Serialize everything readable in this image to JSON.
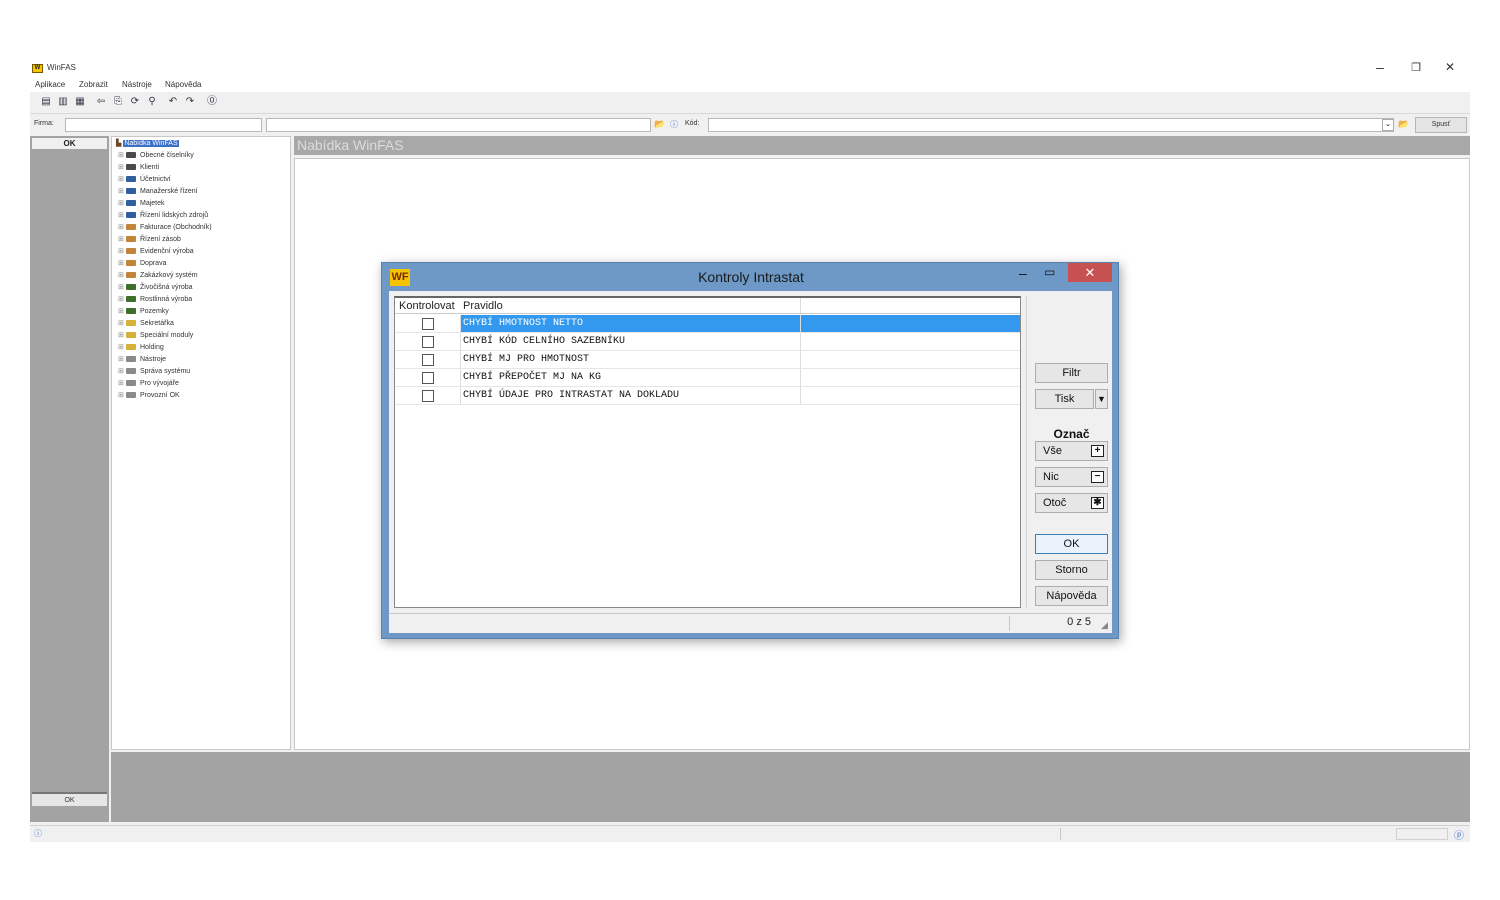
{
  "window": {
    "title": "WinFAS",
    "controls": {
      "minimize": "–",
      "restore": "❐",
      "close": "✕"
    }
  },
  "menu": [
    "Aplikace",
    "Zobrazit",
    "Nástroje",
    "Nápověda"
  ],
  "firma_row": {
    "firma_label": "Firma:",
    "kod_label": "Kód:",
    "spust_label": "Spusť"
  },
  "left_panel": {
    "ok_top": "OK",
    "ok_bottom": "OK"
  },
  "tree": {
    "root": "Nabídka WinFAS",
    "items": [
      {
        "label": "Obecné číselníky",
        "color": "#4a4a4a"
      },
      {
        "label": "Klienti",
        "color": "#4a4a4a"
      },
      {
        "label": "Účetnictví",
        "color": "#2f5f9f"
      },
      {
        "label": "Manažerské řízení",
        "color": "#2f5f9f"
      },
      {
        "label": "Majetek",
        "color": "#2f5f9f"
      },
      {
        "label": "Řízení lidských zdrojů",
        "color": "#2f5f9f"
      },
      {
        "label": "Fakturace (Obchodník)",
        "color": "#c0843a"
      },
      {
        "label": "Řízení zásob",
        "color": "#c0843a"
      },
      {
        "label": "Evidenční výroba",
        "color": "#c0843a"
      },
      {
        "label": "Doprava",
        "color": "#c0843a"
      },
      {
        "label": "Zakázkový systém",
        "color": "#c0843a"
      },
      {
        "label": "Živočišná výroba",
        "color": "#3f6e2b"
      },
      {
        "label": "Rostlinná výroba",
        "color": "#3f6e2b"
      },
      {
        "label": "Pozemky",
        "color": "#3f6e2b"
      },
      {
        "label": "Sekretářka",
        "color": "#d4b23a"
      },
      {
        "label": "Speciální moduly",
        "color": "#d4b23a"
      },
      {
        "label": "Holding",
        "color": "#d4b23a"
      },
      {
        "label": "Nástroje",
        "color": "#8a8a8a"
      },
      {
        "label": "Správa systému",
        "color": "#8a8a8a"
      },
      {
        "label": "Pro vývojáře",
        "color": "#8a8a8a"
      },
      {
        "label": "Provozní OK",
        "color": "#8a8a8a"
      }
    ]
  },
  "main": {
    "header": "Nabídka WinFAS"
  },
  "dialog": {
    "title": "Kontroly Intrastat",
    "logo": "WF",
    "close": "✕",
    "columns": [
      "Kontrolovat",
      "Pravidlo"
    ],
    "rows": [
      {
        "rule": "CHYBÍ HMOTNOST NETTO",
        "checked": false,
        "selected": true
      },
      {
        "rule": "CHYBÍ KÓD CELNÍHO SAZEBNÍKU",
        "checked": false,
        "selected": false
      },
      {
        "rule": "CHYBÍ MJ PRO HMOTNOST",
        "checked": false,
        "selected": false
      },
      {
        "rule": "CHYBÍ PŘEPOČET MJ NA KG",
        "checked": false,
        "selected": false
      },
      {
        "rule": "CHYBÍ ÚDAJE PRO INTRASTAT NA DOKLADU",
        "checked": false,
        "selected": false
      }
    ],
    "buttons": {
      "filtr": "Filtr",
      "tisk": "Tisk",
      "tisk_drop": "▼",
      "oznac_label": "Označ",
      "vse": "Vše",
      "vse_icon": "+",
      "nic": "Nic",
      "nic_icon": "−",
      "otoc": "Otoč",
      "otoc_icon": "✱",
      "ok": "OK",
      "storno": "Storno",
      "napoveda": "Nápověda"
    },
    "status_count": "0 z 5",
    "accent": "#3399ee",
    "titlebar_color": "#6e98c6"
  }
}
